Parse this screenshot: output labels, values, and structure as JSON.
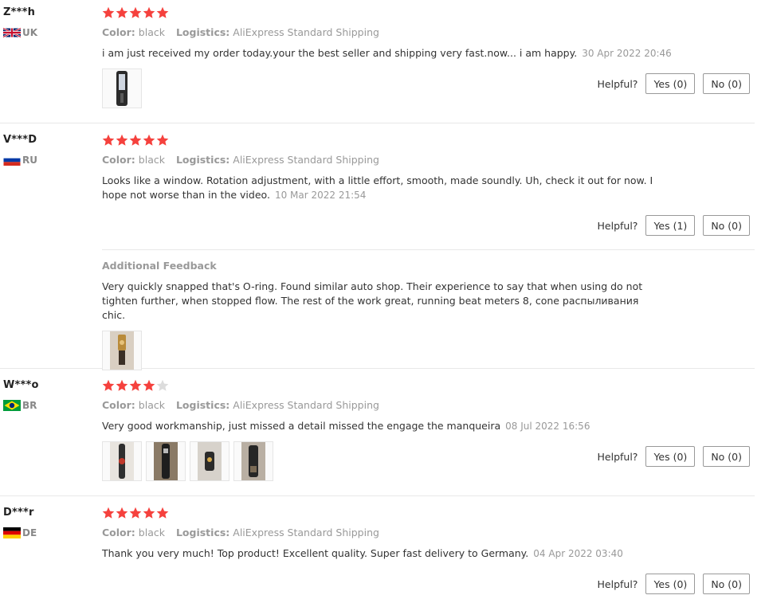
{
  "helpful_label": "Helpful?",
  "color_key": "Color:",
  "logistics_key": "Logistics:",
  "star_color_on": "#f5413d",
  "star_color_off": "#dcdcdc",
  "reviews": [
    {
      "user": "Z***h",
      "country": "UK",
      "rating": 5,
      "color": "black",
      "logistics": "AliExpress Standard Shipping",
      "text": "i am just received my order today.your the best seller and shipping very fast.now... i am happy.",
      "date": "30 Apr 2022 20:46",
      "yes": "Yes (0)",
      "no": "No (0)"
    },
    {
      "user": "V***D",
      "country": "RU",
      "rating": 5,
      "color": "black",
      "logistics": "AliExpress Standard Shipping",
      "text": "Looks like a window. Rotation adjustment, with a little effort, smooth, made soundly. Uh, check it out for now. I hope not worse than in the video.",
      "date": "10 Mar 2022 21:54",
      "yes": "Yes (1)",
      "no": "No (0)",
      "additional_title": "Additional Feedback",
      "additional_text": "Very quickly snapped that's O-ring. Found similar auto shop. Their experience to say that when using do not tighten further, when stopped flow. The rest of the work great, running beat meters 8, cone распыливания chic."
    },
    {
      "user": "W***o",
      "country": "BR",
      "rating": 4,
      "color": "black",
      "logistics": "AliExpress Standard Shipping",
      "text": "Very good workmanship, just missed a detail missed the engage the manqueira",
      "date": "08 Jul 2022 16:56",
      "yes": "Yes (0)",
      "no": "No (0)"
    },
    {
      "user": "D***r",
      "country": "DE",
      "rating": 5,
      "color": "black",
      "logistics": "AliExpress Standard Shipping",
      "text": "Thank you very much! Top product! Excellent quality. Super fast delivery to Germany.",
      "date": "04 Apr 2022 03:40",
      "yes": "Yes (0)",
      "no": "No (0)"
    }
  ]
}
